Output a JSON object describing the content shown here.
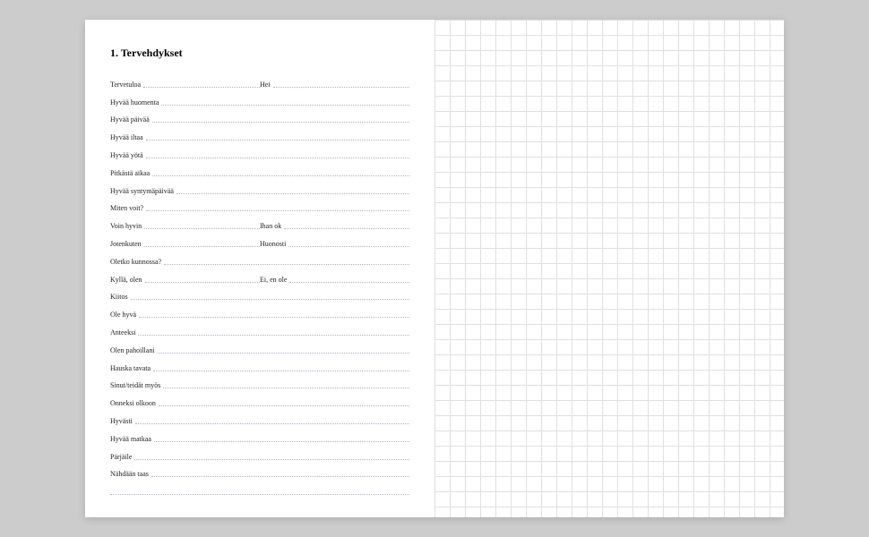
{
  "heading": "1. Tervehdykset",
  "rows": [
    {
      "type": "split",
      "left": "Tervetuloa",
      "right": "Hei"
    },
    {
      "type": "full",
      "text": "Hyvää huomenta"
    },
    {
      "type": "full",
      "text": "Hyvää päivää"
    },
    {
      "type": "full",
      "text": "Hyvää iltaa"
    },
    {
      "type": "full",
      "text": "Hyvää yötä"
    },
    {
      "type": "full",
      "text": "Pitkästä aikaa"
    },
    {
      "type": "full",
      "text": "Hyvää syntymäpäivää"
    },
    {
      "type": "full",
      "text": "Miten voit?"
    },
    {
      "type": "split",
      "left": "Voin hyvin",
      "right": "Ihan ok"
    },
    {
      "type": "split",
      "left": "Jotenkuten",
      "right": "Huonosti"
    },
    {
      "type": "full",
      "text": "Oletko kunnossa?"
    },
    {
      "type": "split",
      "left": "Kyllä, olen",
      "right": "Ei, en ole"
    },
    {
      "type": "full",
      "text": "Kiitos"
    },
    {
      "type": "full",
      "text": "Ole hyvä"
    },
    {
      "type": "full",
      "text": "Anteeksi"
    },
    {
      "type": "full",
      "text": "Olen pahoillani"
    },
    {
      "type": "full",
      "text": "Hauska tavata"
    },
    {
      "type": "full",
      "text": "Sinut/teidät myös"
    },
    {
      "type": "full",
      "text": "Onneksi olkoon"
    },
    {
      "type": "full",
      "text": "Hyvästi"
    },
    {
      "type": "full",
      "text": "Hyvää matkaa"
    },
    {
      "type": "full",
      "text": "Pärjäile"
    },
    {
      "type": "full",
      "text": "Nähdään taas"
    },
    {
      "type": "blank"
    }
  ]
}
